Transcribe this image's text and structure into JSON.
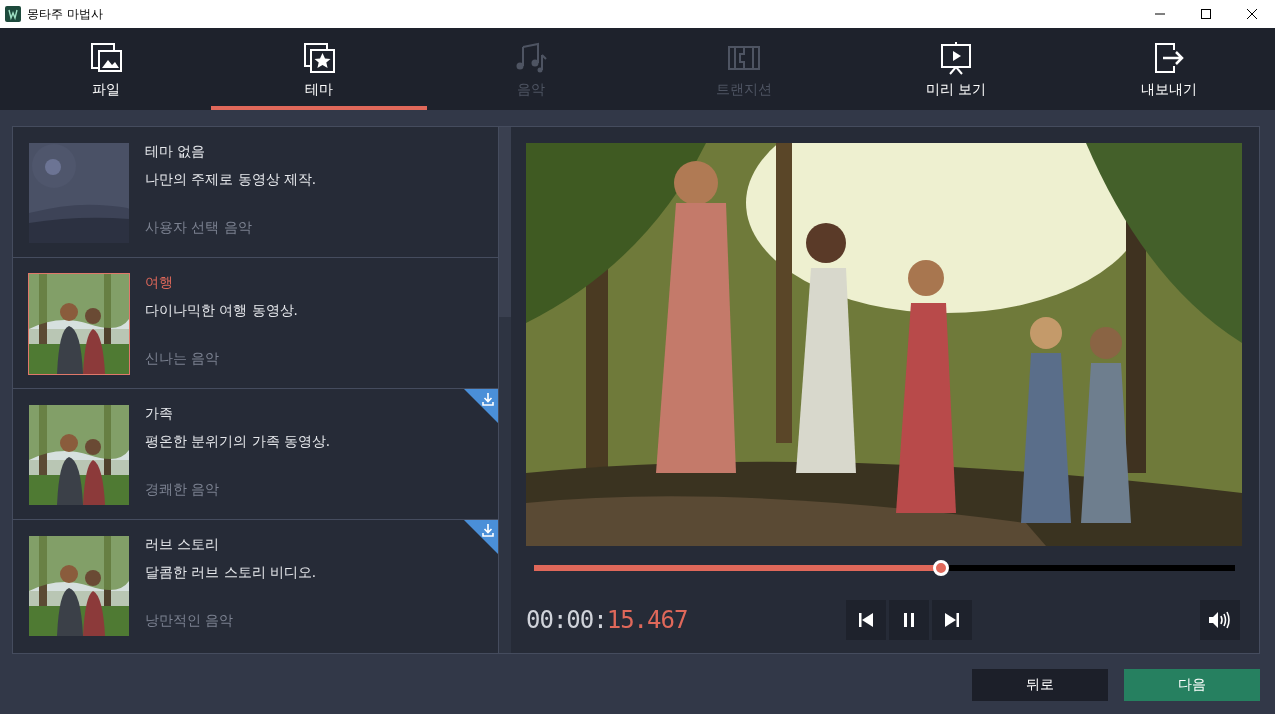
{
  "window": {
    "title": "몽타주 마법사"
  },
  "tabs": [
    {
      "label": "파일",
      "kind": "files",
      "selected": false,
      "disabled": false
    },
    {
      "label": "테마",
      "kind": "theme",
      "selected": true,
      "disabled": false
    },
    {
      "label": "음악",
      "kind": "music",
      "selected": false,
      "disabled": true
    },
    {
      "label": "트랜지션",
      "kind": "transition",
      "selected": false,
      "disabled": true
    },
    {
      "label": "미리 보기",
      "kind": "preview",
      "selected": false,
      "disabled": false
    },
    {
      "label": "내보내기",
      "kind": "export",
      "selected": false,
      "disabled": false
    }
  ],
  "themes": [
    {
      "title": "테마 없음",
      "description": "나만의 주제로 동영상 제작.",
      "music": "사용자 선택 음악",
      "selected": false,
      "downloadable": false
    },
    {
      "title": "여행",
      "description": "다이나믹한 여행 동영상.",
      "music": "신나는 음악",
      "selected": true,
      "downloadable": false
    },
    {
      "title": "가족",
      "description": "평온한 분위기의 가족 동영상.",
      "music": "경쾌한 음악",
      "selected": false,
      "downloadable": true
    },
    {
      "title": "러브 스토리",
      "description": "달콤한 러브 스토리 비디오.",
      "music": "낭만적인 음악",
      "selected": false,
      "downloadable": true
    }
  ],
  "player": {
    "level": 0.58,
    "time_elapsed": "00:00:",
    "time_fraction": "15.467",
    "playing": true
  },
  "buttons": [
    {
      "label": "뒤로",
      "kind": "back"
    },
    {
      "label": "다음",
      "kind": "next"
    }
  ]
}
